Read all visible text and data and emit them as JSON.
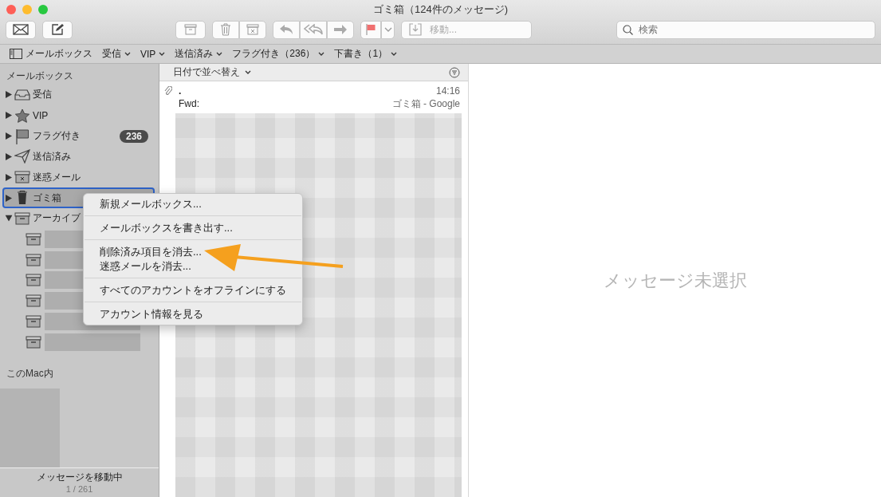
{
  "window": {
    "title": "ゴミ箱（124件のメッセージ)"
  },
  "toolbar": {
    "move_label": "移動...",
    "search": {
      "placeholder": "検索"
    }
  },
  "favorites_bar": [
    {
      "kind": "mailboxes",
      "label": "メールボックス"
    },
    {
      "kind": "menu",
      "label": "受信"
    },
    {
      "kind": "menu",
      "label": "VIP"
    },
    {
      "kind": "menu",
      "label": "送信済み"
    },
    {
      "kind": "menu",
      "label": "フラグ付き（236）"
    },
    {
      "kind": "menu",
      "label": "下書き（1）"
    }
  ],
  "sidebar": {
    "section": "メールボックス",
    "items": [
      {
        "kind": "inbox",
        "label": "受信",
        "expanded": false,
        "selected": false
      },
      {
        "kind": "star",
        "label": "VIP",
        "expanded": false,
        "selected": false
      },
      {
        "kind": "flag",
        "label": "フラグ付き",
        "badge": "236",
        "expanded": false,
        "selected": false
      },
      {
        "kind": "sent",
        "label": "送信済み",
        "expanded": false,
        "selected": false
      },
      {
        "kind": "junk",
        "label": "迷惑メール",
        "expanded": false,
        "selected": false
      },
      {
        "kind": "trash",
        "label": "ゴミ箱",
        "expanded": false,
        "selected": true
      },
      {
        "kind": "archive",
        "label": "アーカイブ",
        "expanded": true,
        "selected": false,
        "children": [
          {
            "kind": "redacted"
          },
          {
            "kind": "redacted"
          },
          {
            "kind": "redacted"
          },
          {
            "kind": "redacted"
          },
          {
            "kind": "redacted"
          },
          {
            "kind": "redacted"
          }
        ]
      }
    ],
    "local_section": "このMac内",
    "status": {
      "text": "メッセージを移動中",
      "progress": "1 / 261"
    }
  },
  "message_list": {
    "sort_label": "日付で並べ替え",
    "messages": [
      {
        "attachment": true,
        "sender": ".",
        "subject": "Fwd:",
        "time": "14:16",
        "mailbox": "ゴミ箱 - Google"
      }
    ]
  },
  "preview": {
    "empty_text": "メッセージ未選択"
  },
  "context_menu": {
    "groups": [
      [
        "新規メールボックス..."
      ],
      [
        "メールボックスを書き出す..."
      ],
      [
        "削除済み項目を消去...",
        "迷惑メールを消去..."
      ],
      [
        "すべてのアカウントをオフラインにする"
      ],
      [
        "アカウント情報を見る"
      ]
    ]
  },
  "annotation": {
    "kind": "arrow"
  }
}
